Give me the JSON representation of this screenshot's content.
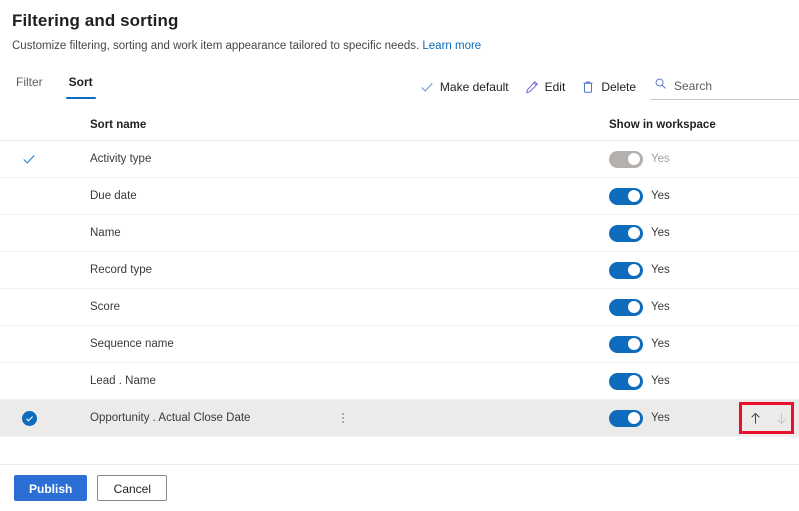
{
  "header": {
    "title": "Filtering and sorting",
    "subtitle": "Customize filtering, sorting and work item appearance tailored to specific needs.",
    "link_label": "Learn more"
  },
  "tabs": [
    {
      "label": "Filter",
      "active": false
    },
    {
      "label": "Sort",
      "active": true
    }
  ],
  "commands": {
    "make_default": "Make default",
    "edit": "Edit",
    "delete": "Delete",
    "search_placeholder": "Search",
    "search_value": ""
  },
  "table": {
    "columns": {
      "sort_name": "Sort name",
      "show_in_workspace": "Show in workspace"
    },
    "rows": [
      {
        "name": "Activity type",
        "default": true,
        "selected": false,
        "toggle_on": false,
        "toggle_label": "Yes",
        "toggle_disabled": true
      },
      {
        "name": "Due date",
        "default": false,
        "selected": false,
        "toggle_on": true,
        "toggle_label": "Yes",
        "toggle_disabled": false
      },
      {
        "name": "Name",
        "default": false,
        "selected": false,
        "toggle_on": true,
        "toggle_label": "Yes",
        "toggle_disabled": false
      },
      {
        "name": "Record type",
        "default": false,
        "selected": false,
        "toggle_on": true,
        "toggle_label": "Yes",
        "toggle_disabled": false
      },
      {
        "name": "Score",
        "default": false,
        "selected": false,
        "toggle_on": true,
        "toggle_label": "Yes",
        "toggle_disabled": false
      },
      {
        "name": "Sequence name",
        "default": false,
        "selected": false,
        "toggle_on": true,
        "toggle_label": "Yes",
        "toggle_disabled": false
      },
      {
        "name": "Lead . Name",
        "default": false,
        "selected": false,
        "toggle_on": true,
        "toggle_label": "Yes",
        "toggle_disabled": false
      },
      {
        "name": "Opportunity . Actual Close Date",
        "default": false,
        "selected": true,
        "toggle_on": true,
        "toggle_label": "Yes",
        "toggle_disabled": false,
        "has_overflow": true,
        "move_up_enabled": true,
        "move_down_enabled": false
      }
    ]
  },
  "footer": {
    "publish": "Publish",
    "cancel": "Cancel"
  },
  "colors": {
    "accent": "#0f6cbd",
    "primary_button": "#2b6fd4",
    "highlight_box": "#e8112d",
    "row_selected": "#edebe9",
    "toggle_off": "#b3b0ad"
  }
}
